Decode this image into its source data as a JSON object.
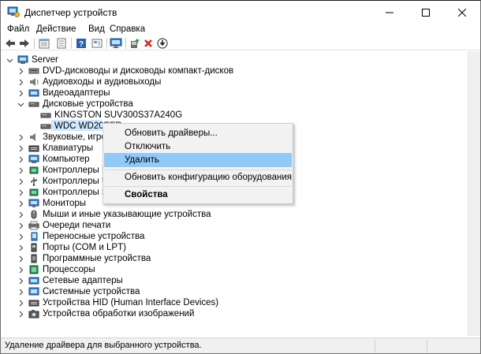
{
  "window": {
    "title": "Диспетчер устройств"
  },
  "menu": {
    "file": "Файл",
    "action": "Действие",
    "view": "Вид",
    "help": "Справка"
  },
  "toolbar": {
    "icons": [
      "back-arrow-icon",
      "forward-arrow-icon",
      "show-hidden-icon",
      "properties-icon",
      "help-icon",
      "refresh-icon",
      "monitor-icon",
      "add-driver-icon",
      "remove-device-icon",
      "download-driver-icon"
    ],
    "accent_green": "#1e9e3a",
    "accent_red": "#d9261c"
  },
  "tree": {
    "root": "Server",
    "items": [
      "DVD-дисководы и дисководы компакт-дисков",
      "Аудиовходы и аудиовыходы",
      "Видеоадаптеры",
      "Дисковые устройства",
      "KINGSTON SUV300S37A240G",
      "WDC WD20EFR",
      "Звуковые, игровы",
      "Клавиатуры",
      "Компьютер",
      "Контроллеры IDE",
      "Контроллеры USB",
      "Контроллеры запо",
      "Мониторы",
      "Мыши и иные указывающие устройства",
      "Очереди печати",
      "Переносные устройства",
      "Порты (COM и LPT)",
      "Программные устройства",
      "Процессоры",
      "Сетевые адаптеры",
      "Системные устройства",
      "Устройства HID (Human Interface Devices)",
      "Устройства обработки изображений"
    ]
  },
  "context_menu": {
    "update_drivers": "Обновить драйверы...",
    "disable": "Отключить",
    "uninstall": "Удалить",
    "scan_hardware": "Обновить конфигурацию оборудования",
    "properties": "Свойства",
    "highlight_color": "#91c9f7"
  },
  "status": {
    "text": "Удаление драйвера для выбранного устройства."
  }
}
